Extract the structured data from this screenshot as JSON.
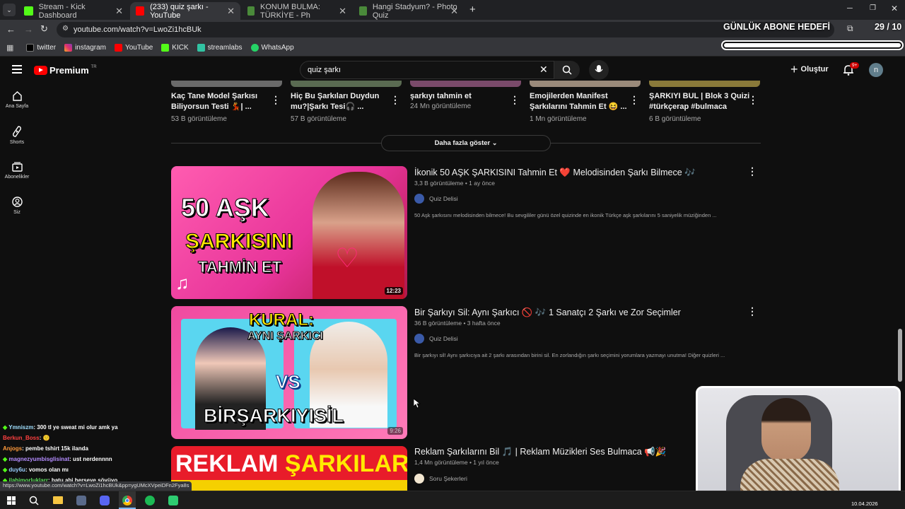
{
  "tabs": [
    {
      "label": "Stream - Kick Dashboard",
      "fav": "#53fc18"
    },
    {
      "label": "(233) quiz şarkı - YouTube",
      "fav": "#ff0000"
    },
    {
      "label": "KONUM BULMA: TÜRKİYE - Ph",
      "fav": "#4a8a3a"
    },
    {
      "label": "Hangi Stadyum? - Photo Quiz",
      "fav": "#4a8a3a"
    }
  ],
  "address": "youtube.com/watch?v=LwoZi1hcBUk",
  "bookmarks": [
    "twitter",
    "instagram",
    "YouTube",
    "KICK",
    "streamlabs",
    "WhatsApp"
  ],
  "overlay": {
    "goal_label": "GÜNLÜK ABONE HEDEFİ",
    "goal_count": "29 / 10",
    "goal_progress": 1.0
  },
  "yt": {
    "logo": "Premium",
    "region": "TR",
    "search": "quiz şarkı",
    "create": "Oluştur",
    "notif": "9+",
    "avatar": "n"
  },
  "nav": [
    "Ana Sayfa",
    "Shorts",
    "Abonelikler",
    "Siz"
  ],
  "shorts": [
    {
      "title1": "Kaç Tane Model Şarkısı",
      "title2": "Biliyorsun Testi 💃| ...",
      "views": "53 B görüntüleme"
    },
    {
      "title1": "Hiç Bu Şarkıları Duydun",
      "title2": "mu?|Şarkı Tesi🎧 ...",
      "views": "57 B görüntüleme"
    },
    {
      "title1": "şarkıyı tahmin et",
      "title2": "",
      "views": "24 Mn görüntüleme"
    },
    {
      "title1": "Emojilerden Manifest",
      "title2": "Şarkılarını Tahmin Et 😆 ...",
      "views": "1 Mn görüntüleme"
    },
    {
      "title1": "ŞARKIYI BUL | Blok 3 Quizi",
      "title2": "#türkçerap #bulmaca",
      "views": "6 B görüntüleme"
    }
  ],
  "show_more": "Daha fazla göster",
  "videos": [
    {
      "title": "İkonik 50 AŞK ŞARKISINI Tahmin Et ❤️ Melodisinden Şarkı Bilmece 🎶",
      "meta": "3,3 B görüntüleme • 1 ay önce",
      "channel": "Quiz Delisi",
      "desc": "50 Aşk şarkısını melodisinden bilmece! Bu sevgililer günü özel quizinde en ikonik Türkçe aşk şarkılarını 5 saniyelik müziğinden ...",
      "duration": "12:23",
      "thumb_lines": [
        "50 AŞK",
        "ŞARKISINI",
        "TAHMİN ET"
      ]
    },
    {
      "title": "Bir Şarkıyı Sil: Aynı Şarkıcı 🚫 🎶 1 Sanatçı 2 Şarkı ve Zor Seçimler",
      "meta": "36 B görüntüleme • 3 hafta önce",
      "channel": "Quiz Delisi",
      "desc": "Bir şarkıyı sil! Aynı şarkıcıya ait 2 şarkı arasından birini sil. En zorlandığın şarkı seçimini yorumlara yazmayı unutma! Diğer quizleri ...",
      "duration": "9:26",
      "thumb_lines": [
        "KURAL:",
        "AYNI ŞARKICI",
        "VS",
        "BİRŞARKIYISİL"
      ]
    },
    {
      "title": "Reklam Şarkılarını Bil 🎵 | Reklam Müzikleri Ses Bulmaca 📢🎉",
      "meta": "1,4 Mn görüntüleme • 1 yıl önce",
      "channel": "Soru Şekerleri",
      "desc": "",
      "duration": "",
      "thumb_lines": [
        "REKLAM",
        "ŞARKILARI"
      ]
    }
  ],
  "chat": [
    {
      "user": "Ymniszm",
      "msg": ": 300 tl ye sweat mi olur amk ya",
      "color": "#a0e0ff"
    },
    {
      "user": "Berkun_Boss",
      "msg": ": 🙂",
      "color": "#ff4040"
    },
    {
      "user": "Anjogs",
      "msg": ": pembe tshirt 15k ilanda",
      "color": "#ff9a3c"
    },
    {
      "user": "magnezyumbisglisinat",
      "msg": ": ust nerdennnn",
      "color": "#b48cff"
    },
    {
      "user": "duy6u",
      "msg": ": vomos olan mı",
      "color": "#9ad0ff"
    },
    {
      "user": "ilahimorluklarr",
      "msg": ": batu abi herseye sövüyo",
      "color": "#60e060"
    }
  ],
  "status_url": "https://www.youtube.com/watch?v=LwoZi1hcBUk&pp=ygUMcXVpeiDFn2Fya8s",
  "clock": "10.04.2026"
}
